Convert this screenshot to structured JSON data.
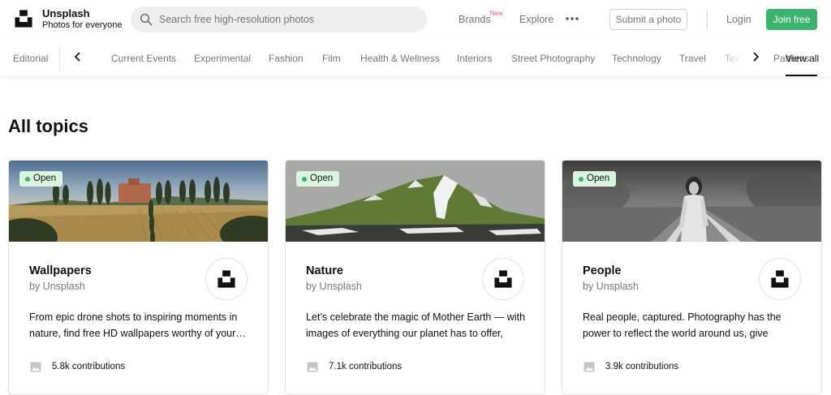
{
  "header": {
    "brand_name": "Unsplash",
    "brand_tagline": "Photos for everyone",
    "search_placeholder": "Search free high-resolution photos",
    "nav": {
      "brands": "Brands",
      "brands_badge": "New",
      "explore": "Explore"
    },
    "submit_label": "Submit a photo",
    "login_label": "Login",
    "join_label": "Join free"
  },
  "topic_nav": {
    "items": [
      "Editorial",
      "Current Events",
      "Experimental",
      "Fashion",
      "Film",
      "Health & Wellness",
      "Interiors",
      "Street Photography",
      "Technology",
      "Travel",
      "Textures & Patterns"
    ],
    "view_all": "View all"
  },
  "main": {
    "title": "All topics",
    "cards": [
      {
        "status": "Open",
        "title": "Wallpapers",
        "author": "by Unsplash",
        "description": "From epic drone shots to inspiring moments in nature, find free HD wallpapers worthy of your…",
        "contributions": "5.8k contributions"
      },
      {
        "status": "Open",
        "title": "Nature",
        "author": "by Unsplash",
        "description": "Let’s celebrate the magic of Mother Earth — with images of everything our planet has to offer, fro…",
        "contributions": "7.1k contributions"
      },
      {
        "status": "Open",
        "title": "People",
        "author": "by Unsplash",
        "description": "Real people, captured. Photography has the power to reflect the world around us, give voice…",
        "contributions": "3.9k contributions"
      }
    ]
  },
  "colors": {
    "accent_green": "#3cb46e",
    "badge_bg": "#d9f5de",
    "muted_text": "#767676",
    "new_badge": "#e2557a"
  },
  "icons": [
    "unsplash-logo",
    "search-icon",
    "more-icon",
    "chevron-left-icon",
    "chevron-right-icon",
    "image-icon"
  ]
}
